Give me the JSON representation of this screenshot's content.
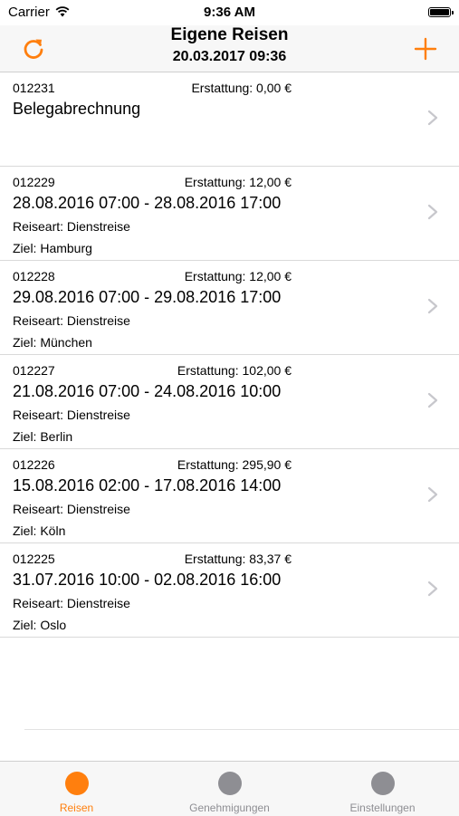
{
  "status_bar": {
    "carrier": "Carrier",
    "time": "9:36 AM",
    "wifi_icon": "wifi-icon",
    "battery_icon": "battery-icon"
  },
  "nav": {
    "title": "Eigene Reisen",
    "subtitle": "20.03.2017 09:36",
    "refresh_icon": "refresh-icon",
    "add_icon": "plus-icon"
  },
  "colors": {
    "accent": "#ff7f0e",
    "inactive": "#8e8e93"
  },
  "trips": [
    {
      "id": "012231",
      "refund": "Erstattung: 0,00 €",
      "headline": "Belegabrechnung",
      "line1": "",
      "line2": ""
    },
    {
      "id": "012229",
      "refund": "Erstattung: 12,00 €",
      "headline": "28.08.2016 07:00 - 28.08.2016 17:00",
      "line1": "Reiseart: Dienstreise",
      "line2": "Ziel: Hamburg"
    },
    {
      "id": "012228",
      "refund": "Erstattung: 12,00 €",
      "headline": "29.08.2016 07:00 - 29.08.2016 17:00",
      "line1": "Reiseart: Dienstreise",
      "line2": "Ziel: München"
    },
    {
      "id": "012227",
      "refund": "Erstattung: 102,00 €",
      "headline": "21.08.2016 07:00 - 24.08.2016 10:00",
      "line1": "Reiseart: Dienstreise",
      "line2": "Ziel: Berlin"
    },
    {
      "id": "012226",
      "refund": "Erstattung: 295,90 €",
      "headline": "15.08.2016 02:00 - 17.08.2016 14:00",
      "line1": "Reiseart: Dienstreise",
      "line2": "Ziel: Köln"
    },
    {
      "id": "012225",
      "refund": "Erstattung: 83,37 €",
      "headline": "31.07.2016 10:00 - 02.08.2016 16:00",
      "line1": "Reiseart: Dienstreise",
      "line2": "Ziel: Oslo"
    }
  ],
  "tabs": [
    {
      "label": "Reisen",
      "active": true
    },
    {
      "label": "Genehmigungen",
      "active": false
    },
    {
      "label": "Einstellungen",
      "active": false
    }
  ]
}
